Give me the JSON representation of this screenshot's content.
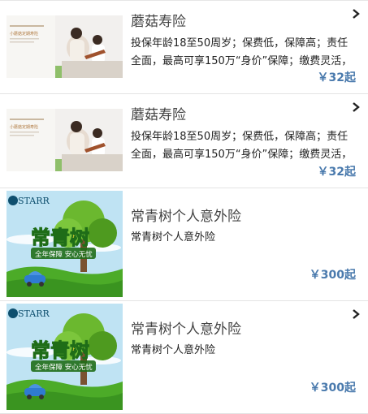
{
  "products": [
    {
      "title": "蘑菇寿险",
      "desc": "投保年龄18至50周岁；保费低，保障高；责任全面，最高可享150万“身价”保障；缴费灵活，投保简单",
      "price": "￥32起",
      "image": "mother-daughter-violin-photo",
      "thumb_text": "小蘑菇定期寿险"
    },
    {
      "title": "蘑菇寿险",
      "desc": "投保年龄18至50周岁；保费低，保障高；责任全面，最高可享150万“身价”保障；缴费灵活，投保简单",
      "price": "￥32起",
      "image": "mother-daughter-violin-photo",
      "thumb_text": "小蘑菇定期寿险"
    },
    {
      "title": "常青树个人意外险",
      "desc": "常青树个人意外险",
      "price": "￥300起",
      "image": "evergreen-tree-car-banner",
      "thumb_brand": "STARR",
      "thumb_headline": "常青树",
      "thumb_slogan": "全年保障 安心无忧"
    },
    {
      "title": "常青树个人意外险",
      "desc": "常青树个人意外险",
      "price": "￥300起",
      "image": "evergreen-tree-car-banner",
      "thumb_brand": "STARR",
      "thumb_headline": "常青树",
      "thumb_slogan": "全年保障 安心无忧"
    }
  ],
  "colors": {
    "price": "#4a7aad",
    "title": "#444444",
    "divider": "#e3e3e3"
  },
  "icons": {
    "chevron": "chevron-right-icon"
  }
}
